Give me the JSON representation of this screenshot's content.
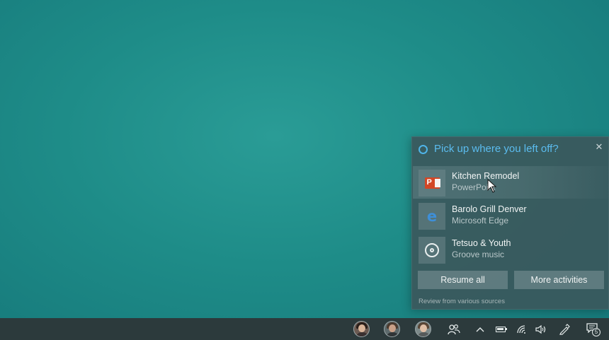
{
  "flyout": {
    "title": "Pick up where you left off?",
    "close_symbol": "✕",
    "activities": [
      {
        "title": "Kitchen Remodel",
        "subtitle": "PowerPoint",
        "icon": "powerpoint-icon",
        "icon_letter": "P"
      },
      {
        "title": "Barolo Grill Denver",
        "subtitle": "Microsoft Edge",
        "icon": "edge-icon",
        "icon_letter": "e"
      },
      {
        "title": "Tetsuo & Youth",
        "subtitle": "Groove music",
        "icon": "groove-music-icon"
      }
    ],
    "resume_all_label": "Resume all",
    "more_activities_label": "More activities",
    "footer_note": "Review from various sources"
  },
  "taskbar": {
    "contacts": [
      "contact-avatar-1",
      "contact-avatar-2",
      "contact-avatar-3"
    ],
    "people_icon": "people-icon",
    "overflow_symbol": "^",
    "notification_count": "5"
  },
  "colors": {
    "accent": "#5bbcef",
    "desktop": "#1e8c88",
    "taskbar": "#2c3a3c",
    "powerpoint": "#d24726",
    "edge": "#3e8fd8"
  }
}
